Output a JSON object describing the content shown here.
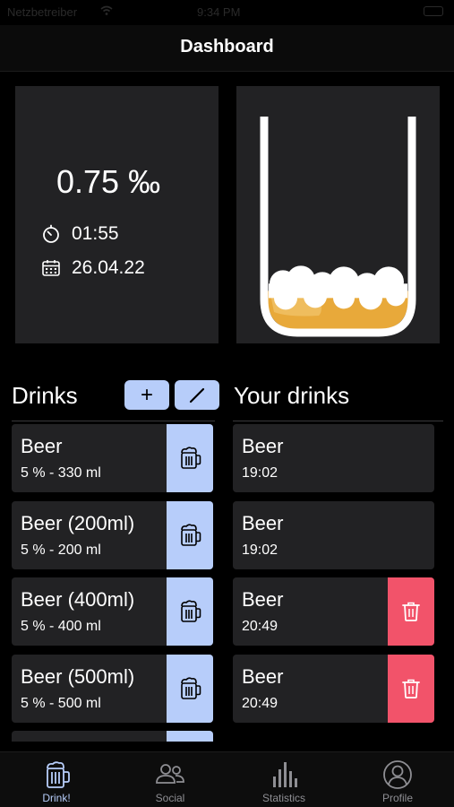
{
  "status_bar": {
    "carrier": "Netzbetreiber",
    "time": "9:34 PM"
  },
  "nav": {
    "title": "Dashboard"
  },
  "bac": {
    "value": "0.75 ‰",
    "timer": "01:55",
    "date": "26.04.22",
    "fill_fraction": 0.18
  },
  "drinks_section": {
    "title": "Drinks",
    "add_label": "+",
    "edit_icon": "pencil-icon"
  },
  "your_drinks_section": {
    "title": "Your drinks"
  },
  "drinks": [
    {
      "name": "Beer",
      "details": "5 % - 330 ml"
    },
    {
      "name": "Beer (200ml)",
      "details": "5 % - 200 ml"
    },
    {
      "name": "Beer (400ml)",
      "details": "5 % - 400 ml"
    },
    {
      "name": "Beer (500ml)",
      "details": "5 % - 500 ml"
    }
  ],
  "your_drinks": [
    {
      "name": "Beer",
      "time": "19:02",
      "deletable": false
    },
    {
      "name": "Beer",
      "time": "19:02",
      "deletable": false
    },
    {
      "name": "Beer",
      "time": "20:49",
      "deletable": true
    },
    {
      "name": "Beer",
      "time": "20:49",
      "deletable": true
    }
  ],
  "tabs": [
    {
      "label": "Drink!",
      "icon": "beer-mug-icon",
      "active": true
    },
    {
      "label": "Social",
      "icon": "people-icon",
      "active": false
    },
    {
      "label": "Statistics",
      "icon": "bar-chart-icon",
      "active": false
    },
    {
      "label": "Profile",
      "icon": "person-circle-icon",
      "active": false
    }
  ],
  "colors": {
    "accent": "#b7cdfa",
    "delete": "#f2536a",
    "card": "#222224",
    "beer": "#e8a93a"
  }
}
